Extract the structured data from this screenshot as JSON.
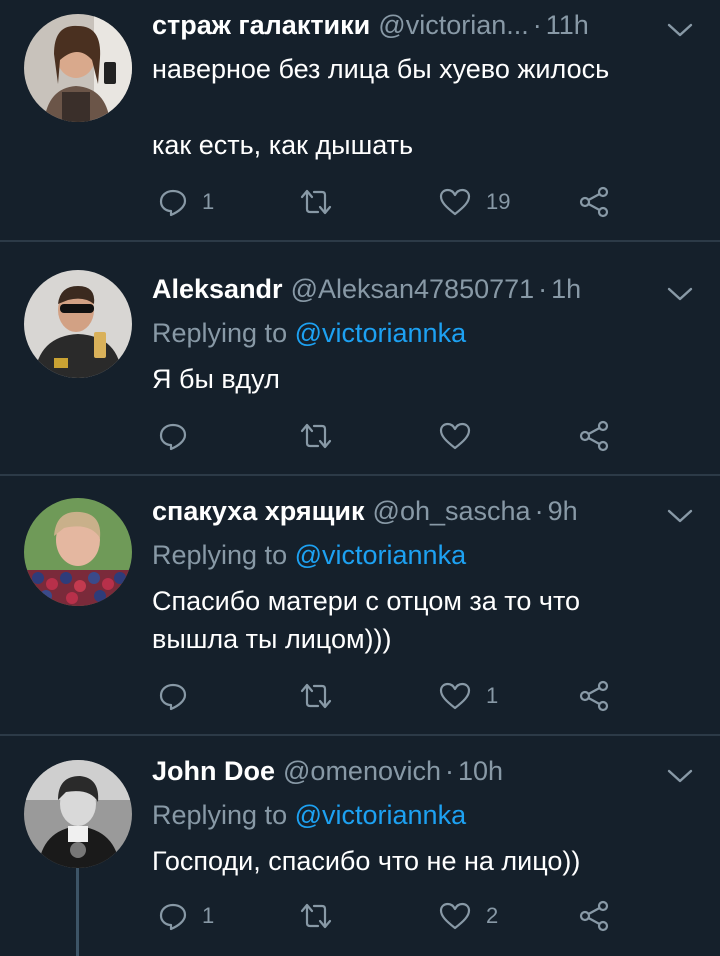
{
  "tweets": [
    {
      "name": "страж галактики",
      "handle": "@victorian...",
      "time": "11h",
      "lines": [
        "наверное без лица бы хуево жилось",
        "",
        "как есть, как дышать"
      ],
      "reply_count": "1",
      "retweet_count": "",
      "like_count": "19"
    },
    {
      "name": "Aleksandr",
      "handle": "@Aleksan47850771",
      "time": "1h",
      "replying_prefix": "Replying to",
      "replying_to": "@victoriannka",
      "lines": [
        "Я бы вдул"
      ],
      "reply_count": "",
      "retweet_count": "",
      "like_count": ""
    },
    {
      "name": "спакуха хрящик",
      "handle": "@oh_sascha",
      "time": "9h",
      "replying_prefix": "Replying to",
      "replying_to": "@victoriannka",
      "lines": [
        "Спасибо матери с отцом за то что",
        "вышла ты лицом)))"
      ],
      "reply_count": "",
      "retweet_count": "",
      "like_count": "1"
    },
    {
      "name": "John Doe",
      "handle": "@omenovich",
      "time": "10h",
      "replying_prefix": "Replying to",
      "replying_to": "@victoriannka",
      "lines": [
        "Господи, спасибо что не на лицо))"
      ],
      "reply_count": "1",
      "retweet_count": "",
      "like_count": "2"
    }
  ],
  "colors": {
    "background": "#15202b",
    "muted": "#8899a6",
    "link": "#1da1f2",
    "divider": "#2c3a47"
  },
  "icons": [
    "reply-icon",
    "retweet-icon",
    "like-icon",
    "share-icon",
    "chevron-down-icon"
  ]
}
